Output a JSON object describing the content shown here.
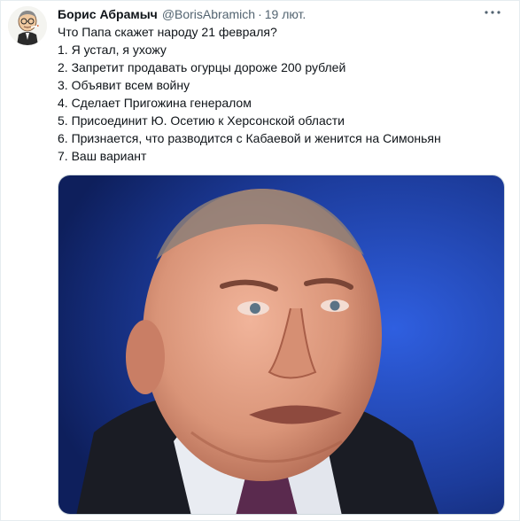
{
  "tweet": {
    "author_name": "Борис Абрамыч",
    "author_handle": "@BorisAbramich",
    "separator": "·",
    "timestamp": "19 лют.",
    "more_icon": "more-horizontal-icon",
    "lines": [
      "Что Папа скажет народу 21 февраля?",
      "1. Я устал, я ухожу",
      "2. Запретит продавать огурцы дороже 200 рублей",
      "3. Объявит всем войну",
      "4. Сделает Пригожина генералом",
      "5. Присоединит Ю. Осетию к Херсонской области",
      "6. Признается, что разводится с Кабаевой и женится на Симоньян",
      "7. Ваш вариант"
    ]
  },
  "colors": {
    "text": "#0f1419",
    "secondary": "#536471",
    "media_background": "#1c3b9a"
  }
}
